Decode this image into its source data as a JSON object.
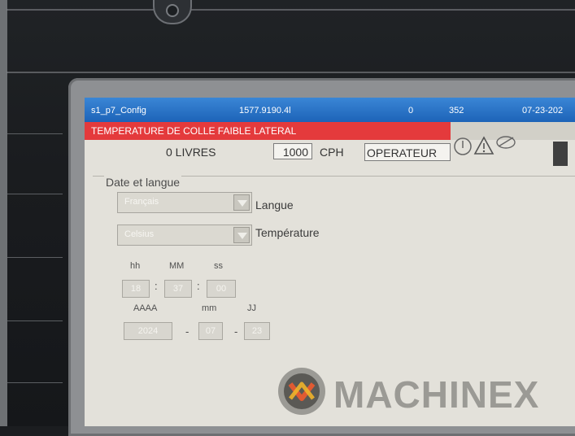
{
  "titlebar": {
    "screen_name": "s1_p7_Config",
    "counter": "1577.9190.4l",
    "value_a": "0",
    "value_b": "352",
    "date": "07-23-202"
  },
  "alarm": {
    "message": "TEMPERATURE DE COLLE FAIBLE LATERAL"
  },
  "status": {
    "weight": "0 LIVRES",
    "rate_value": "1000",
    "rate_unit": "CPH",
    "user_level": "OPERATEUR"
  },
  "config": {
    "section_title": "Date et langue",
    "language": {
      "value": "Français",
      "label": "Langue"
    },
    "temperature": {
      "value": "Celsius",
      "label": "Température"
    },
    "time": {
      "labels": [
        "hh",
        "MM",
        "ss"
      ],
      "values": [
        "18",
        "37",
        "00"
      ]
    },
    "date": {
      "labels": [
        "AAAA",
        "mm",
        "JJ"
      ],
      "values": [
        "2024",
        "07",
        "23"
      ],
      "separator": "-"
    }
  },
  "logo": {
    "text": "MACHINEX"
  },
  "colors": {
    "titlebar": "#1d63b8",
    "alarm": "#e43a3c",
    "screen_bg": "#e3e1da",
    "housing": "#1b1d20"
  }
}
